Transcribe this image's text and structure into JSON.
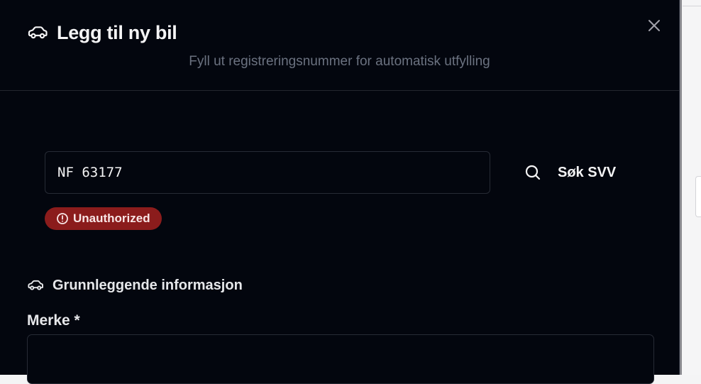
{
  "dialog": {
    "title": "Legg til ny bil",
    "subtitle": "Fyll ut registreringsnummer for automatisk utfylling",
    "close_icon": "close-icon",
    "title_icon": "car-icon"
  },
  "lookup": {
    "reg_number_value": "NF 63177",
    "search_button_label": "Søk SVV",
    "search_icon": "search-icon",
    "error_message": "Unauthorized",
    "error_icon": "alert-circle-icon"
  },
  "section": {
    "title": "Grunnleggende informasjon",
    "icon": "car-icon"
  },
  "fields": {
    "brand_label": "Merke *",
    "brand_value": ""
  },
  "colors": {
    "modal_background": "#03060e",
    "error_badge": "#8b1c1c",
    "muted_text": "#6b7280"
  }
}
